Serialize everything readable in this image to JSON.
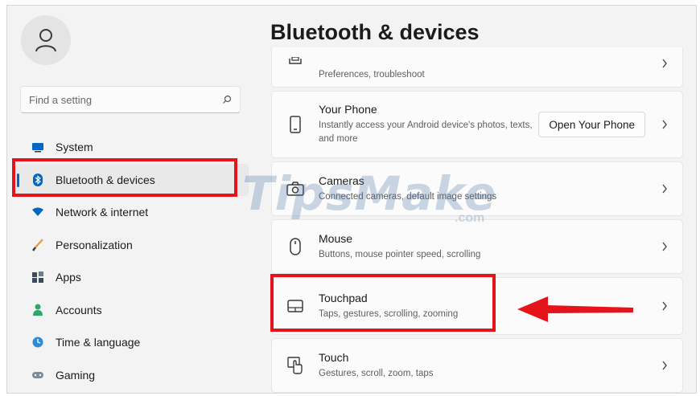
{
  "window": {
    "accent_color": "#0067c0",
    "highlight_color": "#e5141b"
  },
  "page": {
    "title": "Bluetooth & devices"
  },
  "search": {
    "placeholder": "Find a setting",
    "icon": "search-icon"
  },
  "sidebar": {
    "avatar_icon": "user-icon",
    "items": [
      {
        "label": "System",
        "icon": "monitor-icon"
      },
      {
        "label": "Bluetooth & devices",
        "icon": "bluetooth-icon",
        "active": true
      },
      {
        "label": "Network & internet",
        "icon": "wifi-icon"
      },
      {
        "label": "Personalization",
        "icon": "brush-icon"
      },
      {
        "label": "Apps",
        "icon": "apps-icon"
      },
      {
        "label": "Accounts",
        "icon": "person-icon"
      },
      {
        "label": "Time & language",
        "icon": "globe-clock-icon"
      },
      {
        "label": "Gaming",
        "icon": "gamepad-icon"
      }
    ]
  },
  "cards": [
    {
      "name": "",
      "desc": "Preferences, troubleshoot",
      "icon": "printer-icon"
    },
    {
      "name": "Your Phone",
      "desc": "Instantly access your Android device's photos, texts, and more",
      "icon": "phone-icon",
      "button": "Open Your Phone"
    },
    {
      "name": "Cameras",
      "desc": "Connected cameras, default image settings",
      "icon": "camera-icon"
    },
    {
      "name": "Mouse",
      "desc": "Buttons, mouse pointer speed, scrolling",
      "icon": "mouse-icon"
    },
    {
      "name": "Touchpad",
      "desc": "Taps, gestures, scrolling, zooming",
      "icon": "touchpad-icon"
    },
    {
      "name": "Touch",
      "desc": "Gestures, scroll, zoom, taps",
      "icon": "touch-icon"
    }
  ],
  "watermark": {
    "text": "TipsMake",
    "suffix": ".com"
  }
}
